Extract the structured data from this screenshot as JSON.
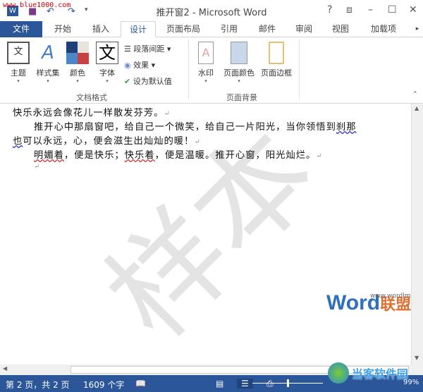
{
  "title_bar": {
    "site_watermark": "www.blue1000.com",
    "title": "推开窗2 - Microsoft Word",
    "help": "?",
    "restore_ribbon": "⧈",
    "minimize": "–",
    "maximize": "☐",
    "close": "✕"
  },
  "tabs": [
    "文件",
    "开始",
    "插入",
    "设计",
    "页面布局",
    "引用",
    "邮件",
    "审阅",
    "视图",
    "加载项"
  ],
  "active_tab": "设计",
  "ribbon": {
    "doc_format": {
      "label": "文档格式",
      "theme": "主题",
      "style_set": "样式集",
      "colors": "颜色",
      "fonts": "字体",
      "paragraph_spacing": "段落间距",
      "effects": "效果",
      "set_default": "设为默认值"
    },
    "page_background": {
      "label": "页面背景",
      "watermark": "水印",
      "page_color": "页面颜色",
      "page_borders": "页面边框"
    }
  },
  "document": {
    "watermark_text": "样本",
    "lines": [
      "快乐永远会像花儿一样散发芬芳。",
      "推开心中那扇窗吧，给自己一个微笑，给自己一片阳光，当你领悟到",
      "刹那",
      "也",
      "可以永远，心，便会滋生出灿灿的暖！",
      "明媚着",
      "，便是快乐；",
      "快乐着",
      "，便是温暖。推开心窗，阳光灿烂。"
    ],
    "para_mark": "↵",
    "logo": {
      "word": "Word",
      "cn": "联盟",
      "url": "www.wordlm.com"
    }
  },
  "status": {
    "page": "第 2 页，共 2 页",
    "words": "1609 个字",
    "zoom": "99%"
  },
  "corner_logo": "当客软件园",
  "colors": {
    "accent": "#2b579a"
  }
}
